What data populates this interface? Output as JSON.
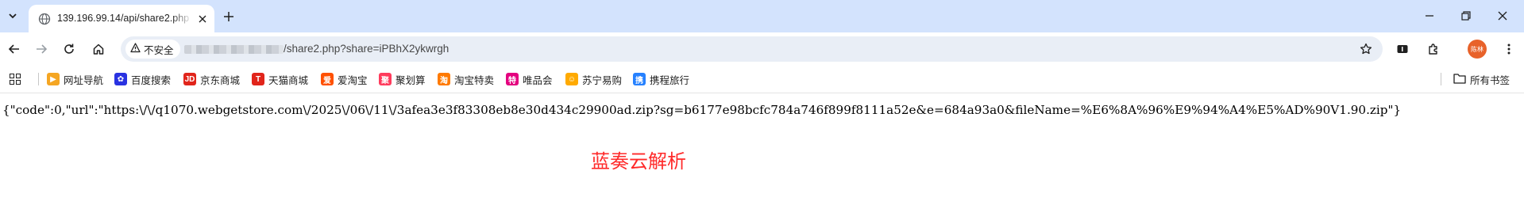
{
  "tab": {
    "title": "139.196.99.14/api/share2.php"
  },
  "toolbar": {
    "security_label": "不安全",
    "url_visible": "/share2.php?share=iPBhX2ykwrgh",
    "avatar_text": "陈林"
  },
  "bookmarks": {
    "items": [
      {
        "label": "网址导航",
        "icon": "directory-icon",
        "color": "#f5a623"
      },
      {
        "label": "百度搜索",
        "icon": "baidu-icon",
        "color": "#2932e1"
      },
      {
        "label": "京东商城",
        "icon": "jd-icon",
        "color": "#e1251b"
      },
      {
        "label": "天猫商城",
        "icon": "tmall-icon",
        "color": "#e1251b"
      },
      {
        "label": "爱淘宝",
        "icon": "aitaobao-icon",
        "color": "#ff5000"
      },
      {
        "label": "聚划算",
        "icon": "juhuasuan-icon",
        "color": "#ff3b5c"
      },
      {
        "label": "淘宝特卖",
        "icon": "taobao-sale-icon",
        "color": "#ff7a00"
      },
      {
        "label": "唯品会",
        "icon": "vip-icon",
        "color": "#e4007f"
      },
      {
        "label": "苏宁易购",
        "icon": "suning-icon",
        "color": "#ffaa00"
      },
      {
        "label": "携程旅行",
        "icon": "ctrip-icon",
        "color": "#2681ff"
      }
    ],
    "all_bookmarks_label": "所有书签"
  },
  "page": {
    "json_text": "{\"code\":0,\"url\":\"https:\\/\\/q1070.webgetstore.com\\/2025\\/06\\/11\\/3afea3e3f83308eb8e30d434c29900ad.zip?sg=b6177e98bcfc784a746f899f8111a52e&e=684a93a0&fileName=%E6%8A%96%E9%94%A4%E5%AD%90V1.90.zip\"}",
    "heading": "蓝奏云解析",
    "heading_color": "#ff2a2a"
  },
  "colors": {
    "tabstrip": "#d3e3fd",
    "omnibox": "#e9eef6"
  }
}
